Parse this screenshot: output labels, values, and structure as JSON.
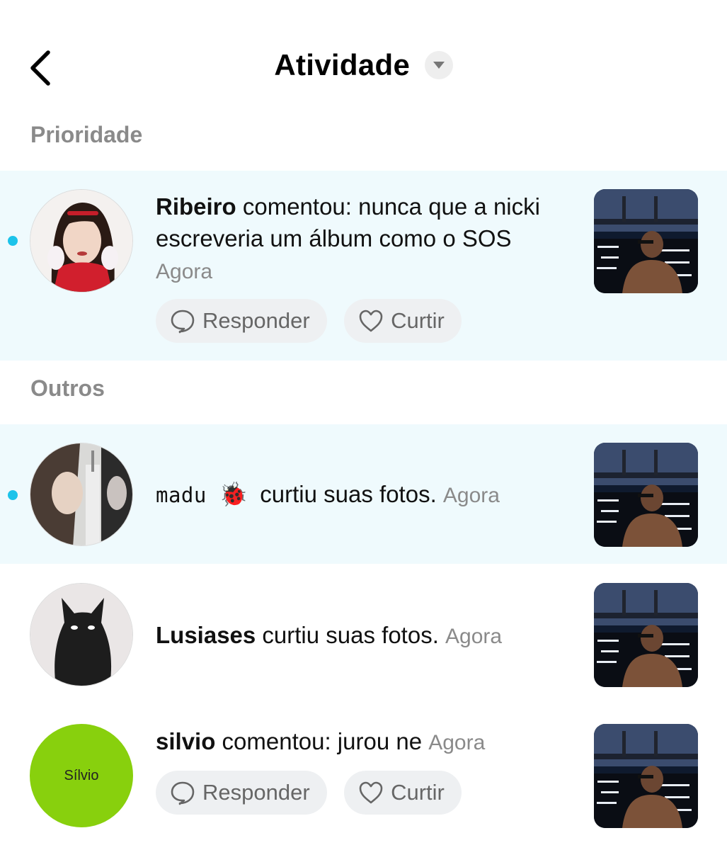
{
  "header": {
    "title": "Atividade"
  },
  "sections": {
    "priority": "Prioridade",
    "others": "Outros"
  },
  "actions": {
    "reply": "Responder",
    "like": "Curtir"
  },
  "colors": {
    "unread_bg": "#effafd",
    "unread_dot": "#1cc3ea",
    "avatar_green": "#88d00d"
  },
  "items": [
    {
      "username": "Ribeiro",
      "message": "comentou: nunca que a nicki escreveria um álbum como o SOS",
      "time": "Agora",
      "unread": true
    },
    {
      "username": "madu",
      "emoji": "🐞",
      "message": "curtiu suas fotos.",
      "time": "Agora",
      "unread": true
    },
    {
      "username": "Lusiases",
      "message": "curtiu suas fotos.",
      "time": "Agora",
      "unread": false
    },
    {
      "username": "silvio",
      "message": "comentou: jurou ne",
      "time": "Agora",
      "unread": false,
      "avatar_text": "Sílvio"
    }
  ]
}
